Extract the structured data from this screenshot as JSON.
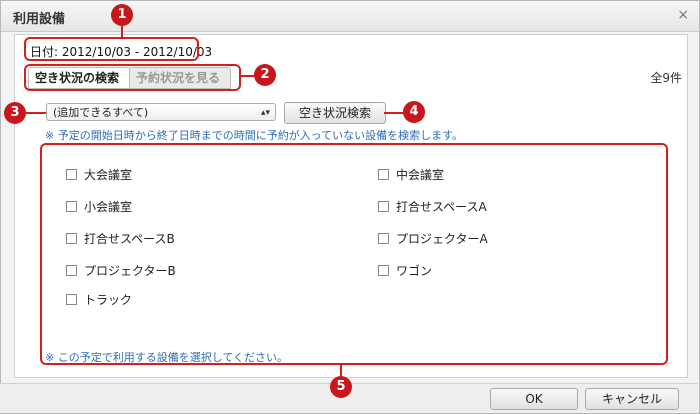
{
  "dialog": {
    "title": "利用設備",
    "close_glyph": "×",
    "date": "日付: 2012/10/03 - 2012/10/03",
    "tabs": [
      {
        "label": "空き状況の検索",
        "active": true
      },
      {
        "label": "予約状況を見る",
        "active": false
      }
    ],
    "count": "全9件",
    "filter": {
      "selected": "(追加できるすべて)",
      "arrow": "▲▼"
    },
    "search_button": "空き状況検索",
    "hint_top": "※ 予定の開始日時から終了日時までの時間に予約が入っていない設備を検索します。",
    "hint_bottom": "※ この予定で利用する設備を選択してください。",
    "equipment": [
      "大会議室",
      "中会議室",
      "小会議室",
      "打合せスペースA",
      "打合せスペースB",
      "プロジェクターA",
      "プロジェクターB",
      "ワゴン",
      "トラック"
    ],
    "ok_button": "OK",
    "cancel_button": "キャンセル"
  },
  "annotations": [
    "1",
    "2",
    "3",
    "4",
    "5"
  ],
  "colors": {
    "annotation": "#d41f1f",
    "hint": "#2e6db4"
  }
}
